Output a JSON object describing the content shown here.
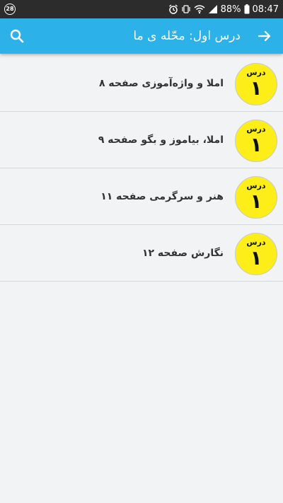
{
  "status_bar": {
    "left_icon": "notification-icon",
    "battery": "88%",
    "time": "08:47"
  },
  "app_bar": {
    "title": "درس اول: محّله ی ما",
    "back_icon": "arrow-right-icon",
    "search_icon": "search-icon",
    "color": "#2cb2e8"
  },
  "lessons": [
    {
      "badge_label": "درس",
      "badge_number": "۱",
      "title": "املا و واژه‌آموزی صفحه ۸"
    },
    {
      "badge_label": "درس",
      "badge_number": "۱",
      "title": "املا، بیاموز و بگو صفحه ۹"
    },
    {
      "badge_label": "درس",
      "badge_number": "۱",
      "title": "هنر و سرگرمی صفحه ۱۱"
    },
    {
      "badge_label": "درس",
      "badge_number": "۱",
      "title": "نگارش صفحه ۱۲"
    }
  ],
  "badge_color": "#fdee1a"
}
